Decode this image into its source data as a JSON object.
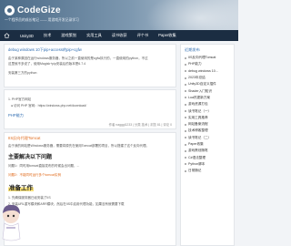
{
  "header": {
    "brand": "CodeGize",
    "tagline": "一个程序员的成长笔记 —— 用游戏开发记录学习"
  },
  "nav": {
    "items": [
      {
        "label": "Unity3D"
      },
      {
        "label": "技术"
      },
      {
        "label": "游戏策划"
      },
      {
        "label": "实用工具"
      },
      {
        "label": "读书收获"
      },
      {
        "label": "评个书"
      },
      {
        "label": "Paper收集"
      }
    ]
  },
  "posts": [
    {
      "title": "debug windows 10下pip+access的pip+cgfw",
      "lines": [
        "由于某种原因在运行windows服务器，所以之前一直使用的是cgfw执行的，一直使用的python，不过",
        "这里就不多说了，使用Magisk+pip安装后的版本是6.7.4",
        "安装第三方的python"
      ],
      "meta": ""
    },
    {
      "title": "PHP能力",
      "lines": [
        "1. PHP官方网站",
        "● 访问 PHP 官网：https://windows.php.net/download/"
      ],
      "meta": "作者 nagggl1233 | 分类 技术 | 浏览 81 | 评论 0"
    },
    {
      "title": "IIS反向代理Tomcat",
      "lines": [
        "由于我的网站是Windows服务器，需要将原先在使用Tomcat部署的项目，所以搭建了这个反向代理。",
        "主要解决以下问题",
        "问题1：同时用tomcat直接发布的时候会出问题，...",
        "问题2：不能同时运行多个tomcat实例",
        "准备工作",
        "1. 先确保服务器已经安装了IIS",
        "2. 安装URL重写模块和ARR模块，然后在IIS中启用代理功能，如果没有就需要下载"
      ],
      "meta": ""
    }
  ],
  "sidebar": {
    "title": "近期发布",
    "items": [
      {
        "label": "IIS反向代理Tomcat"
      },
      {
        "label": "PHP能力"
      },
      {
        "label": "debug windows 10..."
      },
      {
        "label": "2023年总结"
      },
      {
        "label": "Unity3D自定义插件"
      },
      {
        "label": "Shader入门知识"
      },
      {
        "label": "Lua热更新方案"
      },
      {
        "label": "游戏资源打包"
      },
      {
        "label": "读书笔记（一）"
      },
      {
        "label": "实用工具推荐"
      },
      {
        "label": "网站备案流程"
      },
      {
        "label": "技术博客整理"
      },
      {
        "label": "读书笔记（二）"
      },
      {
        "label": "Paper收集"
      },
      {
        "label": "游戏策划随笔"
      },
      {
        "label": "C#语法整理"
      },
      {
        "label": "Python脚本"
      },
      {
        "label": "日常随记"
      }
    ]
  },
  "colors": {
    "nav_bg": "#1b2d42",
    "link": "#2f6db1",
    "accent": "#e06a1b"
  },
  "icons": {
    "home": "home-icon",
    "logo": "logo-icon"
  }
}
